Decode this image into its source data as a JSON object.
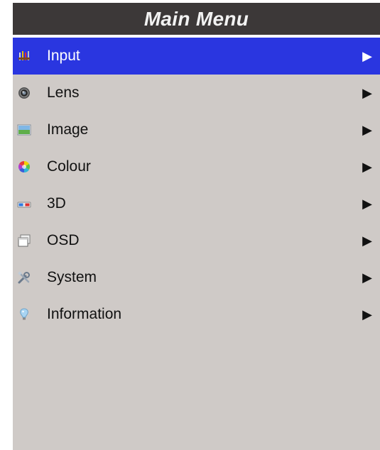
{
  "title": "Main Menu",
  "arrow_glyph": "▶",
  "colors": {
    "header_bg": "#3c3838",
    "menu_bg": "#cfcac7",
    "selected_bg": "#2a36e0"
  },
  "menu": {
    "selected_index": 0,
    "items": [
      {
        "label": "Input",
        "icon": "input-connectors-icon"
      },
      {
        "label": "Lens",
        "icon": "lens-icon"
      },
      {
        "label": "Image",
        "icon": "image-landscape-icon"
      },
      {
        "label": "Colour",
        "icon": "colour-wheel-icon"
      },
      {
        "label": "3D",
        "icon": "3d-glasses-icon"
      },
      {
        "label": "OSD",
        "icon": "osd-windows-icon"
      },
      {
        "label": "System",
        "icon": "system-tools-icon"
      },
      {
        "label": "Information",
        "icon": "info-lightbulb-icon"
      }
    ]
  }
}
